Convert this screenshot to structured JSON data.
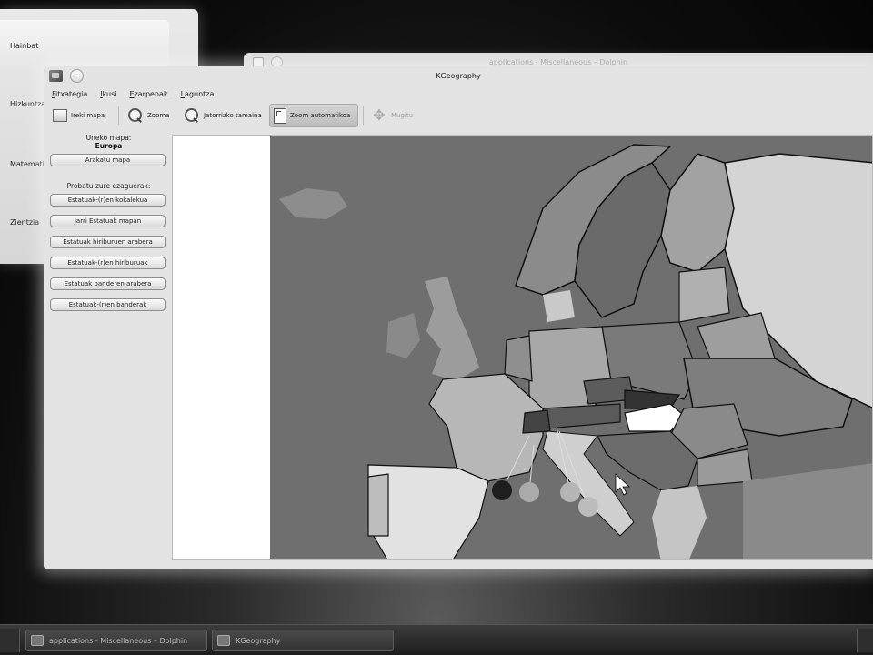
{
  "background_menu": {
    "categories": [
      "Hainbat",
      "Hizkuntza",
      "Matematika",
      "Zientzia"
    ]
  },
  "dolphin": {
    "title": "applications - Miscellaneous – Dolphin"
  },
  "window": {
    "title": "KGeography"
  },
  "menu": [
    "Fitxategia",
    "Ikusi",
    "Ezarpenak",
    "Laguntza"
  ],
  "toolbar": {
    "open_map": "Ireki mapa",
    "zoom": "Zooma",
    "original_size": "Jatorrizko tamaina",
    "auto_zoom": "Zoom automatikoa",
    "move": "Mugitu"
  },
  "side": {
    "current_map_label": "Uneko mapa:",
    "current_map_value": "Europa",
    "browse_button": "Arakatu mapa",
    "test_label": "Probatu zure ezaguerak:",
    "tests": [
      "Estatuak-(r)en kokalekua",
      "Jarri Estatuak mapan",
      "Estatuak hiriburuen arabera",
      "Estatuak-(r)en hiriburuak",
      "Estatuak banderen arabera",
      "Estatuak-(r)en banderak"
    ]
  },
  "taskbar": {
    "items": [
      "applications - Miscellaneous – Dolphin",
      "KGeography"
    ]
  },
  "colors": {
    "sea": "#6f6f6f",
    "highlight": "#ffffff",
    "dark_country": "#3a3a3a"
  }
}
